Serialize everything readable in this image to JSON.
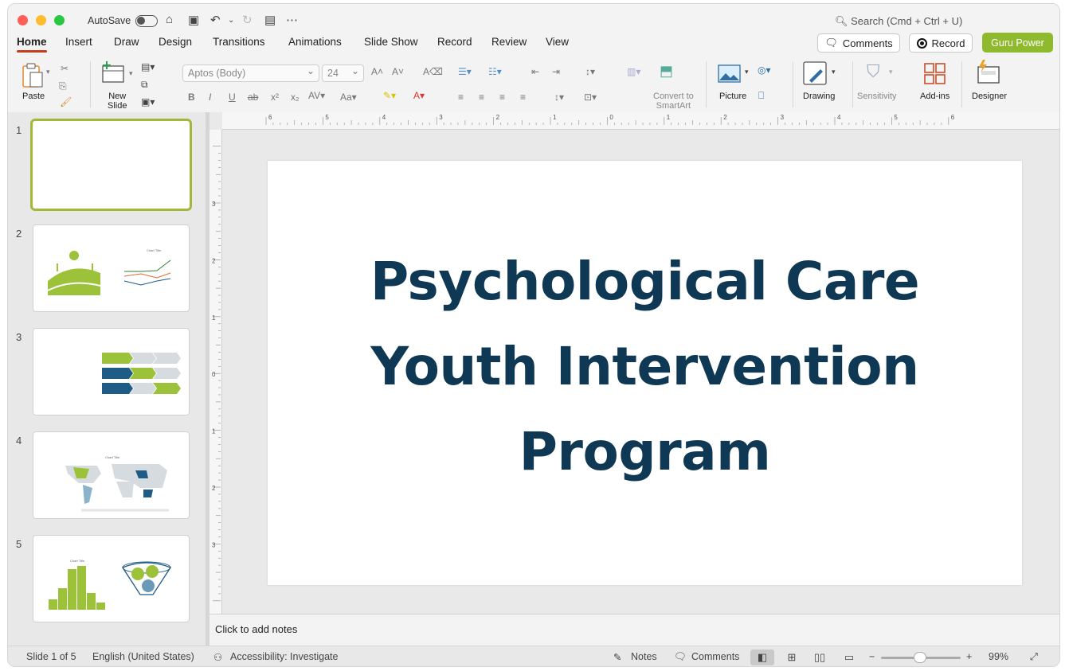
{
  "titlebar": {
    "autosave_label": "AutoSave",
    "search_placeholder": "Search (Cmd + Ctrl + U)"
  },
  "tabs": [
    "Home",
    "Insert",
    "Draw",
    "Design",
    "Transitions",
    "Animations",
    "Slide Show",
    "Record",
    "Review",
    "View"
  ],
  "active_tab": "Home",
  "header_buttons": {
    "comments": "Comments",
    "record": "Record",
    "guru": "Guru Power"
  },
  "ribbon": {
    "paste": "Paste",
    "new_slide_line1": "New",
    "new_slide_line2": "Slide",
    "font_name": "Aptos (Body)",
    "font_size": "24",
    "convert_line1": "Convert to",
    "convert_line2": "SmartArt",
    "picture": "Picture",
    "drawing": "Drawing",
    "sensitivity": "Sensitivity",
    "addins": "Add-ins",
    "designer": "Designer"
  },
  "slides": [
    {
      "number": "1"
    },
    {
      "number": "2",
      "chart_title": "Chart Title"
    },
    {
      "number": "3"
    },
    {
      "number": "4",
      "chart_title": "Chart Title"
    },
    {
      "number": "5",
      "chart_title": "Chart Title"
    }
  ],
  "ruler": {
    "horizontal": [
      "6",
      "5",
      "4",
      "3",
      "2",
      "1",
      "0",
      "1",
      "2",
      "3",
      "4",
      "5",
      "6"
    ],
    "vertical": [
      "3",
      "2",
      "1",
      "0",
      "1",
      "2",
      "3"
    ]
  },
  "main_slide": {
    "title_line1": "Psychological Care",
    "title_line2": "Youth Intervention",
    "title_line3": "Program"
  },
  "notes_placeholder": "Click to add notes",
  "status": {
    "slide_info": "Slide 1 of 5",
    "language": "English (United States)",
    "accessibility": "Accessibility: Investigate",
    "notes": "Notes",
    "comments": "Comments",
    "zoom": "99%"
  },
  "colors": {
    "accent_green": "#8fba2e",
    "title_navy": "#0f3854",
    "tab_underline": "#c43e1c",
    "slide_blue": "#1f5c85"
  }
}
